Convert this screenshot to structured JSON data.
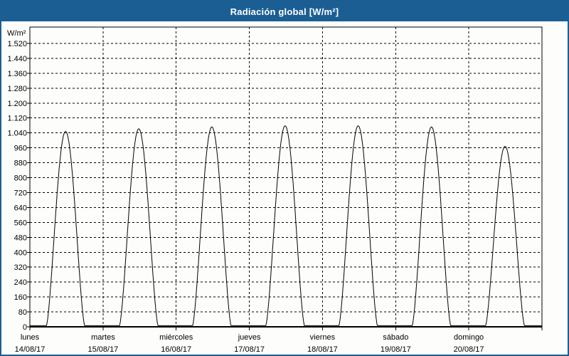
{
  "window": {
    "title": "Radiación global [W/m²]"
  },
  "colors": {
    "accent_blue": "#1b5e94",
    "titlebar_text": "#ffffff",
    "chart_bg": "#fdfefb",
    "grid_line": "#000000",
    "curve_line": "#000000",
    "text": "#000000"
  },
  "chart_data": {
    "type": "line",
    "title": "Radiación global [W/m²]",
    "unit_label": "W/m²",
    "ylabel": "W/m²",
    "xlabel": "",
    "ylim": [
      0,
      1600
    ],
    "ytick_min": 0,
    "ytick_max": 1520,
    "ytick_step": 80,
    "grid": "dashed horizontal and vertical (day boundaries)",
    "legend_position": "none",
    "night_base_wm2": 6,
    "bell_exponent": 1.5,
    "series": [
      {
        "name": "Radiación global",
        "unit": "W/m²",
        "daily_peaks_wm2": [
          1048,
          1062,
          1072,
          1078,
          1078,
          1072,
          968
        ]
      }
    ],
    "days": [
      {
        "name": "lunes",
        "date": "14/08/17",
        "peak_wm2": 1048,
        "sunrise_frac": 0.225,
        "sunset_frac": 0.75
      },
      {
        "name": "martes",
        "date": "15/08/17",
        "peak_wm2": 1062,
        "sunrise_frac": 0.224,
        "sunset_frac": 0.753
      },
      {
        "name": "miércoles",
        "date": "16/08/17",
        "peak_wm2": 1072,
        "sunrise_frac": 0.223,
        "sunset_frac": 0.752
      },
      {
        "name": "jueves",
        "date": "17/08/17",
        "peak_wm2": 1078,
        "sunrise_frac": 0.224,
        "sunset_frac": 0.754
      },
      {
        "name": "viernes",
        "date": "18/08/17",
        "peak_wm2": 1078,
        "sunrise_frac": 0.223,
        "sunset_frac": 0.752
      },
      {
        "name": "sábado",
        "date": "19/08/17",
        "peak_wm2": 1072,
        "sunrise_frac": 0.225,
        "sunset_frac": 0.754
      },
      {
        "name": "domingo",
        "date": "20/08/17",
        "peak_wm2": 968,
        "sunrise_frac": 0.228,
        "sunset_frac": 0.762
      }
    ]
  }
}
